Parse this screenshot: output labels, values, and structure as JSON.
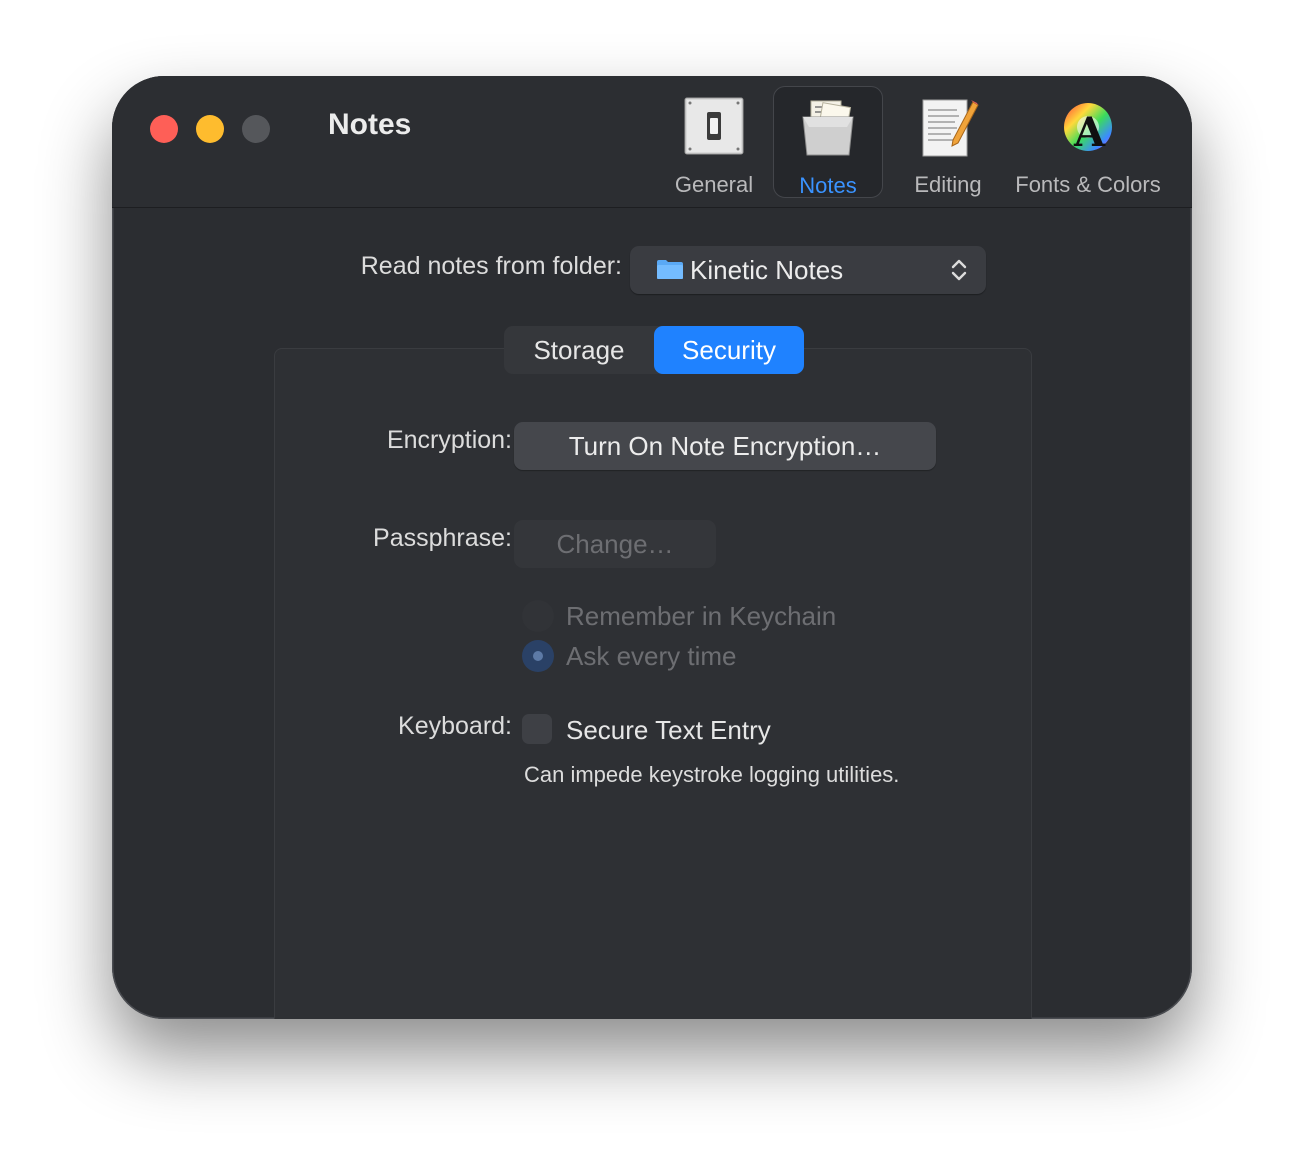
{
  "window": {
    "title": "Notes"
  },
  "toolbar": {
    "items": [
      {
        "label": "General",
        "icon": "switch-icon",
        "selected": false
      },
      {
        "label": "Notes",
        "icon": "notes-box-icon",
        "selected": true
      },
      {
        "label": "Editing",
        "icon": "pencil-document-icon",
        "selected": false
      },
      {
        "label": "Fonts & Colors",
        "icon": "color-wheel-font-icon",
        "selected": false
      }
    ]
  },
  "folder": {
    "label": "Read notes from folder:",
    "value": "Kinetic Notes",
    "icon": "folder-icon"
  },
  "tabs": {
    "items": [
      "Storage",
      "Security"
    ],
    "selected": "Security"
  },
  "security": {
    "encryption_label": "Encryption:",
    "encryption_button": "Turn On Note Encryption…",
    "passphrase_label": "Passphrase:",
    "passphrase_button": "Change…",
    "remember_label": "Remember in Keychain",
    "ask_label": "Ask every time",
    "keyboard_label": "Keyboard:",
    "secure_entry_label": "Secure Text Entry",
    "secure_entry_note": "Can impede keystroke logging utilities."
  },
  "colors": {
    "accent": "#1f82ff",
    "close": "#fe5f57",
    "minimize": "#febc2e",
    "zoom_disabled": "#55575b",
    "window_bg": "#2b2d31"
  }
}
